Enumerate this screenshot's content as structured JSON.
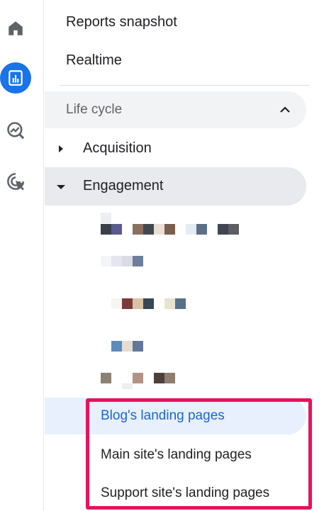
{
  "rail": {
    "items": [
      {
        "name": "home",
        "icon": "home-icon",
        "active": false
      },
      {
        "name": "reports",
        "icon": "bar-chart-icon",
        "active": true
      },
      {
        "name": "explore",
        "icon": "explore-trend-icon",
        "active": false
      },
      {
        "name": "advertising",
        "icon": "target-cursor-icon",
        "active": false
      }
    ]
  },
  "nav": {
    "reports_snapshot": "Reports snapshot",
    "realtime": "Realtime",
    "section_title": "Life cycle",
    "acquisition": "Acquisition",
    "engagement": "Engagement",
    "sub_items": [
      {
        "label": "Blog's landing pages",
        "active": true
      },
      {
        "label": "Main site's landing pages",
        "active": false
      },
      {
        "label": "Support site's landing pages",
        "active": false
      }
    ]
  },
  "colors": {
    "accent": "#1a73e8",
    "active_text": "#1967d2",
    "highlight_bg": "#e8f0fe",
    "annotation_box": "#e8125c"
  }
}
